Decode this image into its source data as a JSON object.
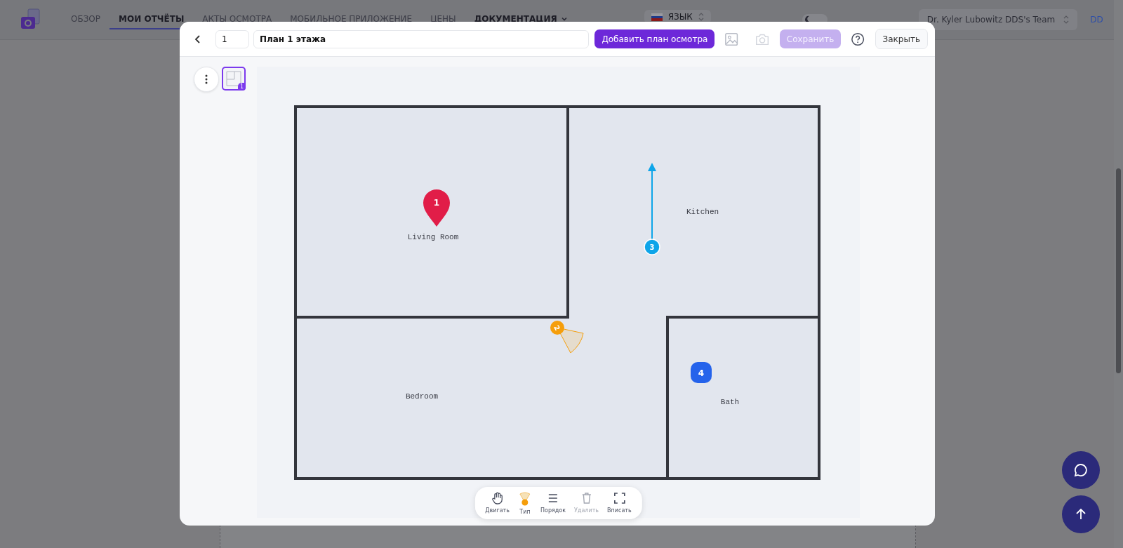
{
  "nav": {
    "items": [
      {
        "label": "ОБЗОР",
        "selected": false,
        "kind": "link"
      },
      {
        "label": "МОИ ОТЧЁТЫ",
        "selected": true,
        "kind": "link"
      },
      {
        "label": "АКТЫ ОСМОТРА",
        "selected": false,
        "kind": "link"
      },
      {
        "label": "МОБИЛЬНОЕ ПРИЛОЖЕНИЕ",
        "selected": false,
        "kind": "link"
      },
      {
        "label": "ЦЕНЫ",
        "selected": false,
        "kind": "link"
      },
      {
        "label": "ДОКУМЕНТАЦИЯ",
        "selected": false,
        "kind": "dropdown"
      }
    ],
    "language": "ЯЗЫК",
    "dark_mode": false,
    "team": "Dr. Kyler Lubowitz DDS's Team",
    "user_initials": "DD"
  },
  "dialog": {
    "page_number": "1",
    "plan_name": "План 1 этажа",
    "add_button": "Добавить план осмотра",
    "save_button": "Сохранить",
    "save_disabled": true,
    "camera_disabled": true,
    "close_button": "Закрыть",
    "thumbnails": [
      {
        "badge": "1",
        "selected": true
      }
    ],
    "rooms": [
      {
        "name": "Living Room"
      },
      {
        "name": "Kitchen"
      },
      {
        "name": "Bedroom"
      },
      {
        "name": "Bath"
      }
    ],
    "markers": [
      {
        "label": "1",
        "kind": "pin",
        "color": "#e11d48"
      },
      {
        "label": "3",
        "kind": "arrow",
        "color": "#0ea5e9"
      },
      {
        "label": "2",
        "kind": "camera",
        "color": "#f59e0b"
      },
      {
        "label": "4",
        "kind": "square",
        "color": "#2563eb"
      }
    ],
    "tools": [
      {
        "label": "Двигать",
        "kind": "move",
        "disabled": false
      },
      {
        "label": "Тип",
        "kind": "type",
        "disabled": false
      },
      {
        "label": "Порядок",
        "kind": "order",
        "disabled": false
      },
      {
        "label": "Удалить",
        "kind": "delete",
        "disabled": true
      },
      {
        "label": "Вписать",
        "kind": "fit",
        "disabled": false
      }
    ]
  }
}
